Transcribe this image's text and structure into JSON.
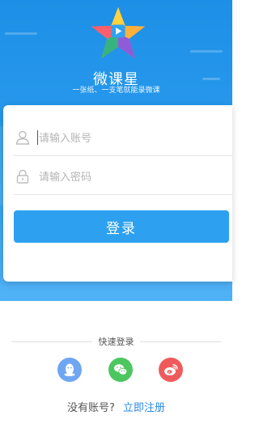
{
  "app": {
    "name": "微课星",
    "slogan": "一张纸、一支笔就能录微课"
  },
  "form": {
    "username_placeholder": "请输入账号",
    "password_placeholder": "请输入密码",
    "login_label": "登录"
  },
  "quick_login": {
    "title": "快速登录",
    "providers": [
      "qq-icon",
      "wechat-icon",
      "weibo-icon"
    ]
  },
  "register": {
    "question": "没有账号?",
    "link_label": "立即注册"
  },
  "colors": {
    "primary": "#2da1ef",
    "qq": "#6fa6f2",
    "wechat": "#4cc65e",
    "weibo": "#ef5b5b",
    "link": "#2a8be0"
  }
}
